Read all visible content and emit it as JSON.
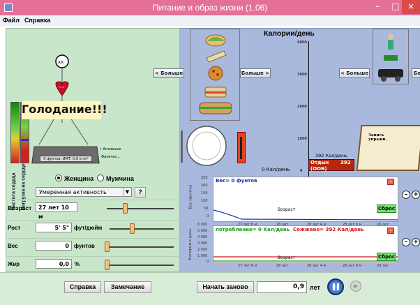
{
  "window": {
    "title": "Питание и образ жизни (1.06)",
    "minimize": "–",
    "maximize": "□",
    "close": "×"
  },
  "menu": {
    "file": "Файл",
    "help": "Справка"
  },
  "left": {
    "heart_rate_label": "Частота сердца",
    "heart_load_label": "Нагрузка на сердце",
    "status_text": "Голодание!!!",
    "scale_readout": "0 фунтов, ИМТ: 0,0 кг/м²",
    "scale_active": "• Активные",
    "scale_fitness": "Физичес...",
    "gender_female": "Женщина",
    "gender_male": "Мужчина",
    "activity_value": "Умеренная активность",
    "help_btn": "?",
    "age_label": "Возраст",
    "age_value": "27 лет 10 м",
    "height_label": "Рост",
    "height_value": "5' 5\"",
    "height_unit": "фут/дюйм",
    "weight_label": "Вес",
    "weight_value": "0",
    "weight_unit": "фунтов",
    "fat_label": "Жир",
    "fat_value": "0,0",
    "fat_unit": "%"
  },
  "right": {
    "more_btn_left": "< Больше",
    "more_btn_right": "Больше >",
    "exercise_more_left": "< Больше",
    "exercise_more_right": "Бо",
    "calories_title": "Калории/день",
    "calorie_ticks": [
      "4000",
      "3000",
      "2000",
      "1000",
      "0"
    ],
    "intake_value": "0 Кал/день",
    "burn_value": "392 Кал/день",
    "rest_label": "Отдых",
    "rest_value": "392",
    "bmr_label": "(ООВ)",
    "exercise_book_label": "Запись упражн.",
    "weight_graph": {
      "title": "Вес= 0 фунтов",
      "ylabel": "Вес (фунты)",
      "yticks": [
        "250",
        "200",
        "150",
        "100",
        "50",
        "0"
      ],
      "xticks": [
        "27 лет 8 м",
        "28 лет",
        "28 лет 4 м",
        "28 лет 8 м",
        "29 лет"
      ],
      "xlabel": "Возраст",
      "reset": "Сброс"
    },
    "calorie_graph": {
      "title_intake": "потребление= 0 Кал/день",
      "title_burned": "Сожжено= 392 Кал/день",
      "ylabel": "Калории в день",
      "yticks": [
        "6 000",
        "5 000",
        "4 000",
        "3 000",
        "2 000",
        "1 000",
        "0"
      ],
      "xticks": [
        "27 лет 8 м",
        "28 лет",
        "28 лет 4 м",
        "28 лет 8 м",
        "29 лет"
      ],
      "xlabel": "Возраст",
      "reset": "Сброс"
    }
  },
  "bottom": {
    "help": "Справка",
    "remark": "Замечание",
    "restart": "Начать заново",
    "time_value": "0,9",
    "time_unit": "лет"
  },
  "colors": {
    "titlebar": "#e4709a",
    "left_panel": "#c8e6c9",
    "right_panel": "#a9b9de",
    "status_bg": "#fff7c2",
    "weight_line": "#1a27b5",
    "intake_line": "#1a9a1a",
    "burn_line": "#d01414"
  }
}
